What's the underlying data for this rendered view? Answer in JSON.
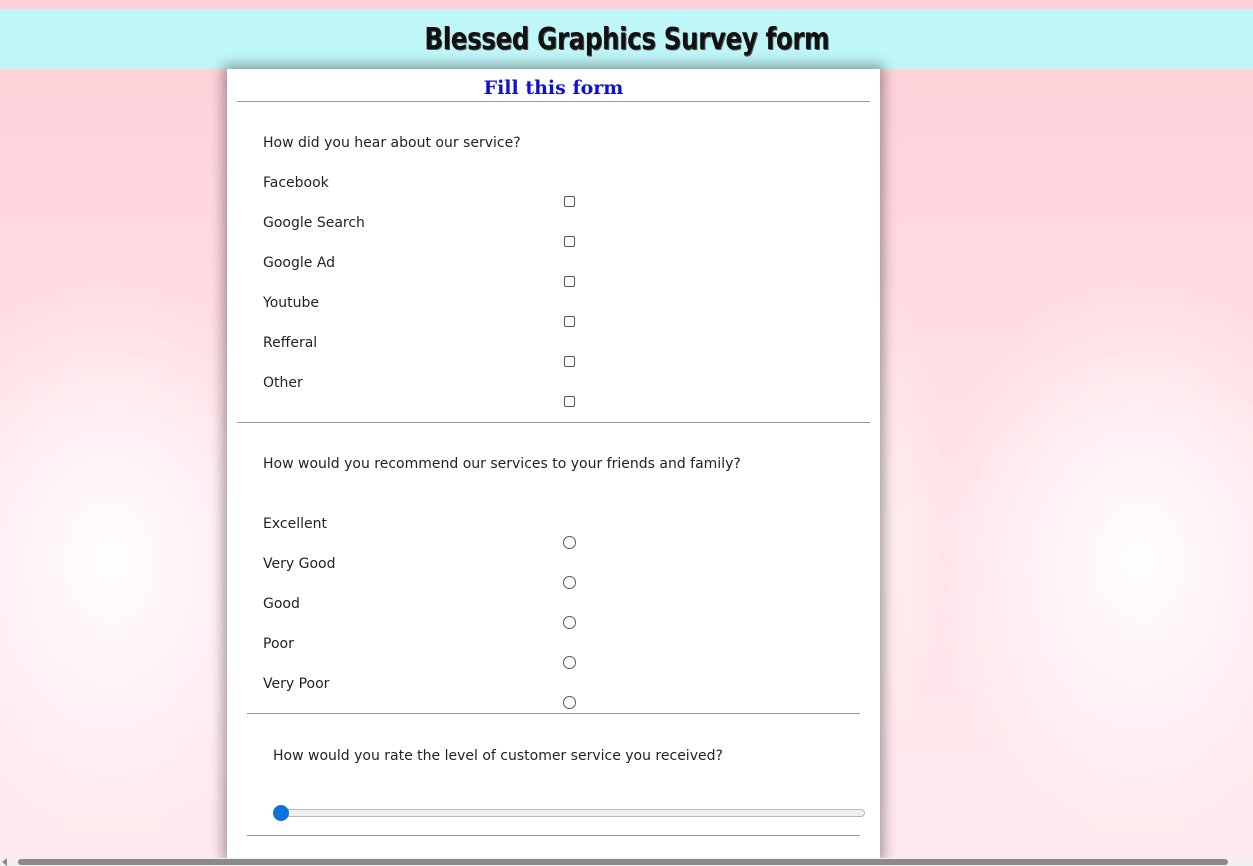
{
  "header": {
    "title": "Blessed Graphics Survey form"
  },
  "form": {
    "subtitle": "Fill this form",
    "hear_about": {
      "question": "How did you hear about our service?",
      "options": [
        {
          "label": "Facebook",
          "checked": false
        },
        {
          "label": "Google Search",
          "checked": false
        },
        {
          "label": "Google Ad",
          "checked": false
        },
        {
          "label": "Youtube",
          "checked": false
        },
        {
          "label": "Refferal",
          "checked": false
        },
        {
          "label": "Other",
          "checked": false
        }
      ]
    },
    "recommend": {
      "question": "How would you recommend our services to your friends and family?",
      "options": [
        {
          "label": "Excellent",
          "selected": false
        },
        {
          "label": "Very Good",
          "selected": false
        },
        {
          "label": "Good",
          "selected": false
        },
        {
          "label": "Poor",
          "selected": false
        },
        {
          "label": "Very Poor",
          "selected": false
        }
      ]
    },
    "customer_service": {
      "question": "How would you rate the level of customer service you received?",
      "slider_value_fraction": 0
    }
  },
  "colors": {
    "header_bg": "#bff6f8",
    "subtitle": "#1010d0",
    "slider_accent": "#0b72d8"
  }
}
